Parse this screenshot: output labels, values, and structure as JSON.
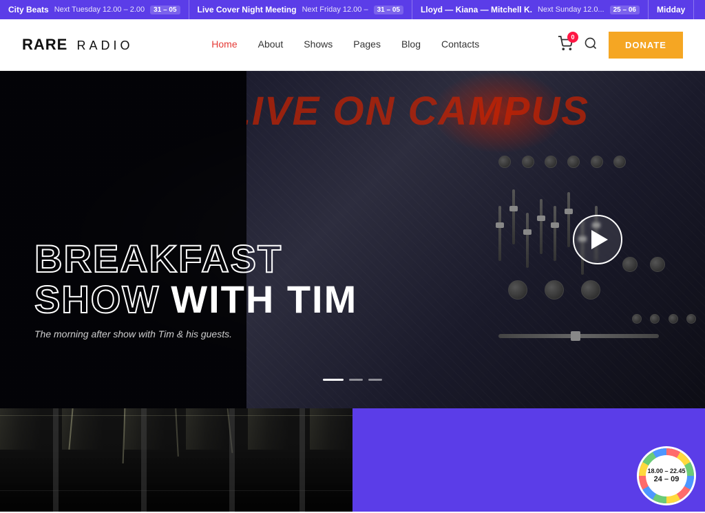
{
  "ticker": {
    "items": [
      {
        "name": "City Beats",
        "time": "Next Tuesday 12.00 – 2.00",
        "date": "31 – 05"
      },
      {
        "name": "Live Cover Night Meeting",
        "time": "Next Friday 12.00 –",
        "date": "31 – 05"
      },
      {
        "name": "Lloyd — Kiana — Mitchell K.",
        "time": "Next Sunday 12.0...",
        "date": "25 – 06"
      },
      {
        "name": "Midday",
        "time": "",
        "date": ""
      }
    ]
  },
  "header": {
    "logo_bold": "RARE",
    "logo_light": "RADIO",
    "nav": [
      {
        "label": "Home",
        "active": true
      },
      {
        "label": "About",
        "active": false
      },
      {
        "label": "Shows",
        "active": false
      },
      {
        "label": "Pages",
        "active": false
      },
      {
        "label": "Blog",
        "active": false
      },
      {
        "label": "Contacts",
        "active": false
      }
    ],
    "cart_count": "0",
    "donate_label": "DONATE"
  },
  "hero": {
    "campus_text": "LIVE ON CAMPUS",
    "title_outline": "BREAKFAST",
    "title_line2_outline": "SHOW",
    "title_line2_filled": "WITH TIM",
    "subtitle": "The morning after show with Tim & his guests.",
    "slide_count": 3
  },
  "bottom": {
    "badge_time": "18.00 – 22.45",
    "badge_date": "24 – 09"
  }
}
